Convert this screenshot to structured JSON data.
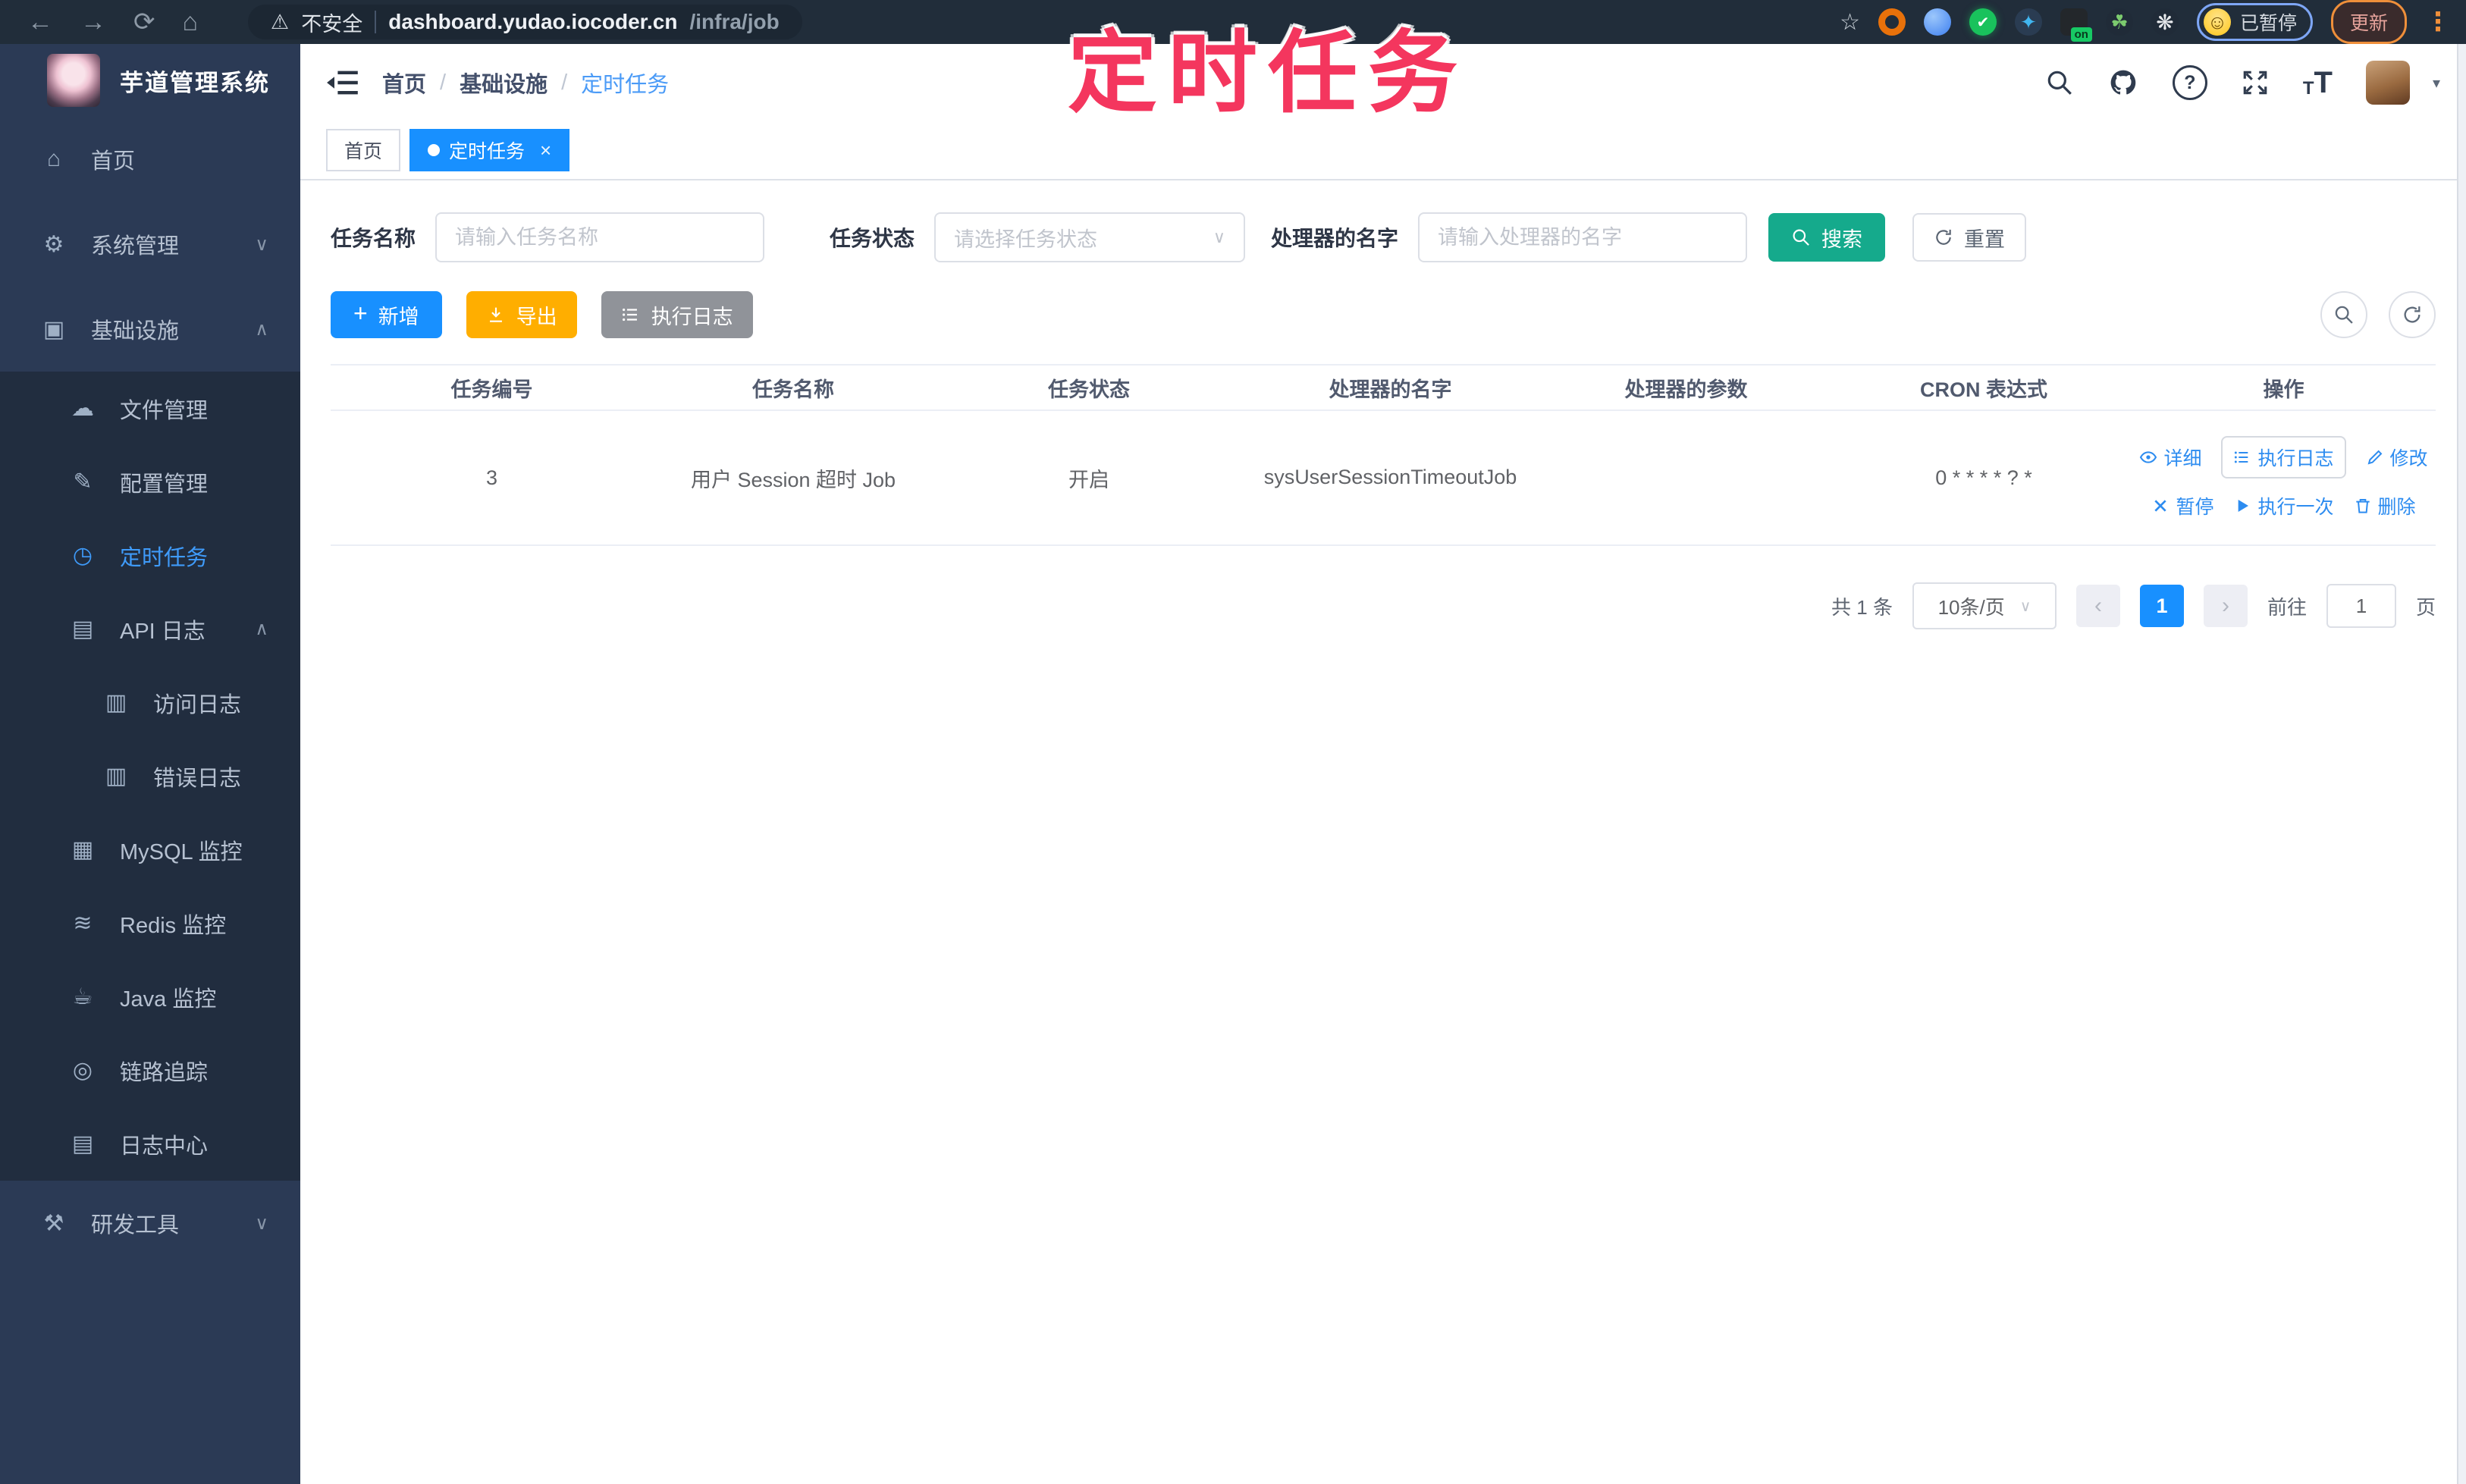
{
  "browser": {
    "security_label": "不安全",
    "url_host": "dashboard.yudao.iocoder.cn",
    "url_path": "/infra/job",
    "on_badge": "on",
    "paused_badge": "已暂停",
    "update_button": "更新"
  },
  "overlay": {
    "title": "定时任务"
  },
  "sidebar": {
    "app_title": "芋道管理系统",
    "items": [
      {
        "label": "首页"
      },
      {
        "label": "系统管理"
      },
      {
        "label": "基础设施"
      },
      {
        "label": "文件管理"
      },
      {
        "label": "配置管理"
      },
      {
        "label": "定时任务"
      },
      {
        "label": "API 日志"
      },
      {
        "label": "访问日志"
      },
      {
        "label": "错误日志"
      },
      {
        "label": "MySQL 监控"
      },
      {
        "label": "Redis 监控"
      },
      {
        "label": "Java 监控"
      },
      {
        "label": "链路追踪"
      },
      {
        "label": "日志中心"
      },
      {
        "label": "研发工具"
      }
    ]
  },
  "header": {
    "separator": "/",
    "breadcrumb": [
      "首页",
      "基础设施",
      "定时任务"
    ]
  },
  "tabs": [
    {
      "label": "首页"
    },
    {
      "label": "定时任务"
    }
  ],
  "filters": {
    "name_label": "任务名称",
    "name_placeholder": "请输入任务名称",
    "status_label": "任务状态",
    "status_placeholder": "请选择任务状态",
    "handler_label": "处理器的名字",
    "handler_placeholder": "请输入处理器的名字",
    "search_button": "搜索",
    "reset_button": "重置"
  },
  "toolbar": {
    "add": "新增",
    "export": "导出",
    "exec_log": "执行日志"
  },
  "table": {
    "headers": [
      "任务编号",
      "任务名称",
      "任务状态",
      "处理器的名字",
      "处理器的参数",
      "CRON 表达式",
      "操作"
    ],
    "row": {
      "id": "3",
      "name": "用户 Session 超时 Job",
      "status": "开启",
      "handler": "sysUserSessionTimeoutJob",
      "param": "",
      "cron": "0 * * * * ? *"
    },
    "actions": [
      "详细",
      "执行日志",
      "修改",
      "暂停",
      "执行一次",
      "删除"
    ]
  },
  "pagination": {
    "total": "共 1 条",
    "page_size": "10条/页",
    "current_page": "1",
    "goto_label": "前往",
    "goto_value": "1",
    "page_unit": "页"
  },
  "icons": {
    "back": "←",
    "forward": "→",
    "reload": "⟳",
    "home_nav": "⌂",
    "warn": "⚠",
    "star": "☆",
    "drop": "◈",
    "check": "✔",
    "spark": "✦",
    "dark": "▣",
    "leaf": "☘",
    "flower": "❋",
    "face": "☺",
    "dots": "⋮",
    "home": "⌂",
    "gear": "⚙",
    "infra": "▣",
    "cloud": "☁",
    "edit": "✎",
    "clock": "◷",
    "log": "▤",
    "sublog": "▥",
    "mysql": "▦",
    "redis": "≋",
    "java": "☕",
    "trace": "◎",
    "logcenter": "▤",
    "tools": "⚒",
    "chevron_down": "∨",
    "chevron_up": "∧",
    "question": "?",
    "font_t": "T",
    "caret": "▾",
    "plus": "+",
    "close": "×",
    "select_arrow": "∨",
    "prev": "‹",
    "next": "›"
  },
  "colors": {
    "primary": "#1890ff",
    "link": "#2d8cf0",
    "search_teal": "#15aa8c",
    "export_amber": "#ffae00",
    "info_gray": "#909399",
    "overlay_red": "#f4365e",
    "sidebar_bg": "#2b3a55",
    "submenu_bg": "#212d3f",
    "chrome_bg": "#212d3a"
  }
}
